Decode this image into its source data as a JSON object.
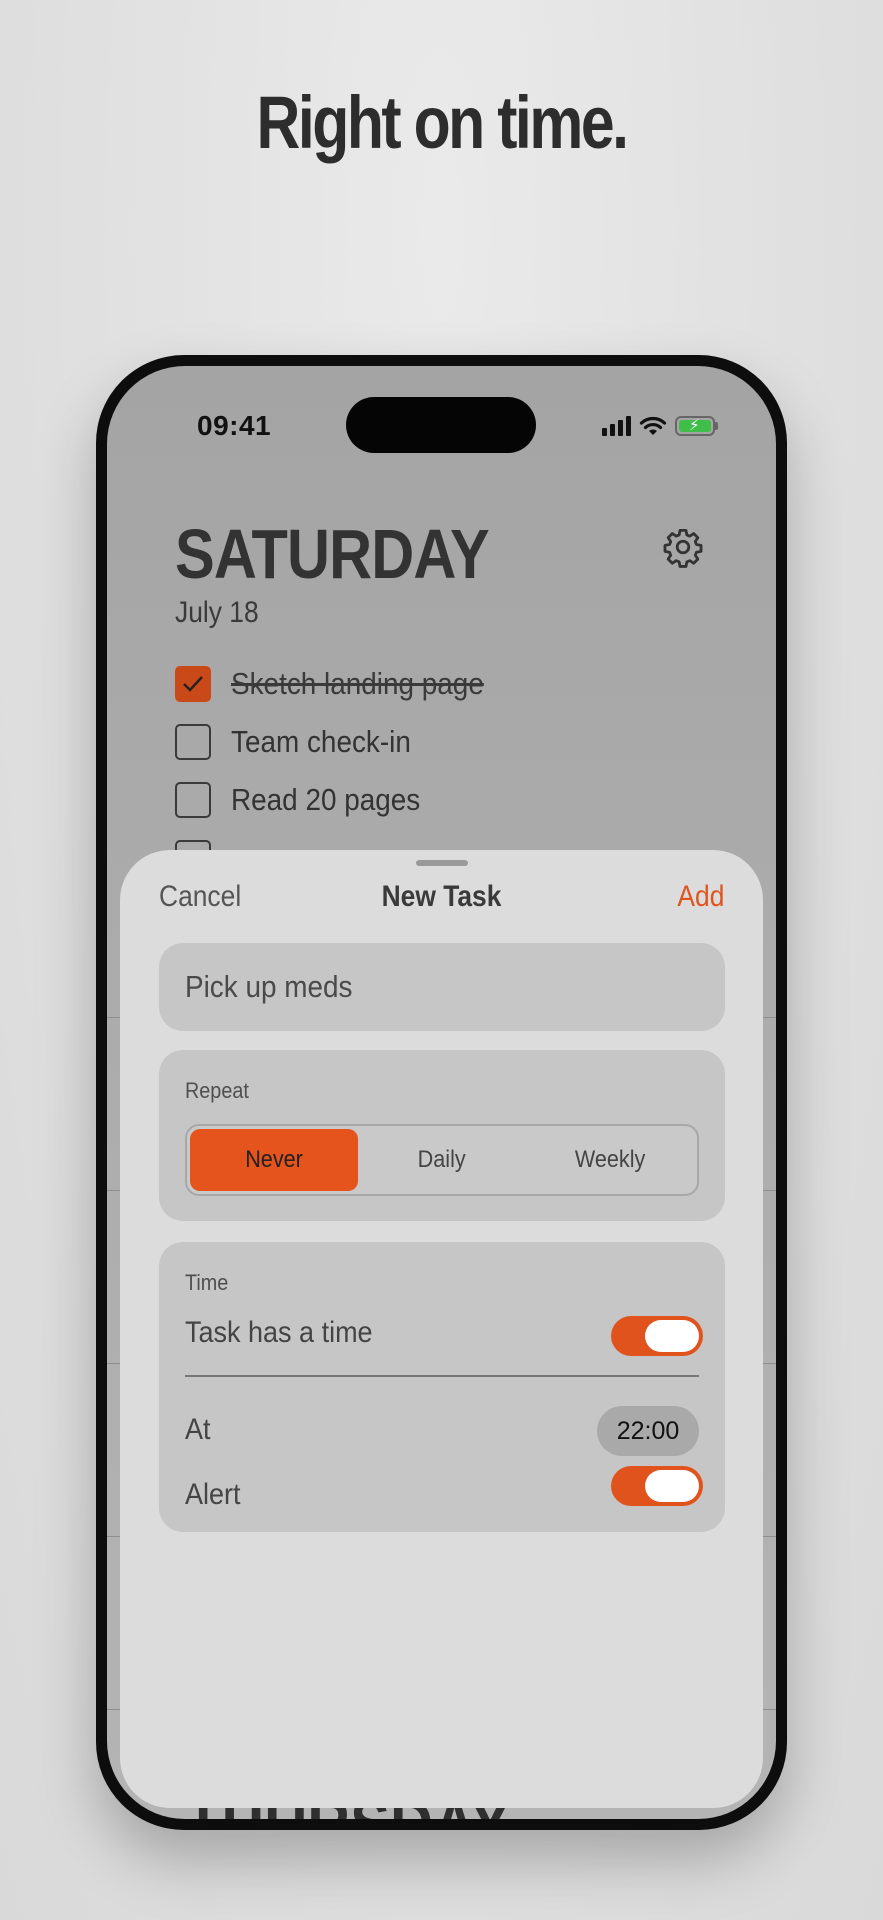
{
  "headline": "Right on time.",
  "status_bar": {
    "time": "09:41",
    "icons": [
      "cellular-signal-icon",
      "wifi-icon",
      "battery-charging-icon"
    ],
    "battery_color": "#3fbf4a"
  },
  "day": {
    "title": "SATURDAY",
    "date": "July 18",
    "settings_icon": "gear-icon"
  },
  "tasks": [
    {
      "label": "Sketch landing page",
      "done": true
    },
    {
      "label": "Team check-in",
      "done": false
    },
    {
      "label": "Read 20 pages",
      "done": false
    }
  ],
  "background_day_title": "THURSDAY",
  "sheet": {
    "cancel": "Cancel",
    "title": "New Task",
    "add": "Add",
    "task_name": "Pick up meds",
    "repeat": {
      "label": "Repeat",
      "options": [
        "Never",
        "Daily",
        "Weekly"
      ],
      "selected": "Never"
    },
    "time_section": {
      "label": "Time",
      "has_time_label": "Task has a time",
      "has_time_on": true,
      "at_label": "At",
      "at_value": "22:00",
      "alert_label": "Alert",
      "alert_on": true
    }
  },
  "colors": {
    "accent": "#e4541c",
    "checkbox_checked": "#c94919"
  }
}
